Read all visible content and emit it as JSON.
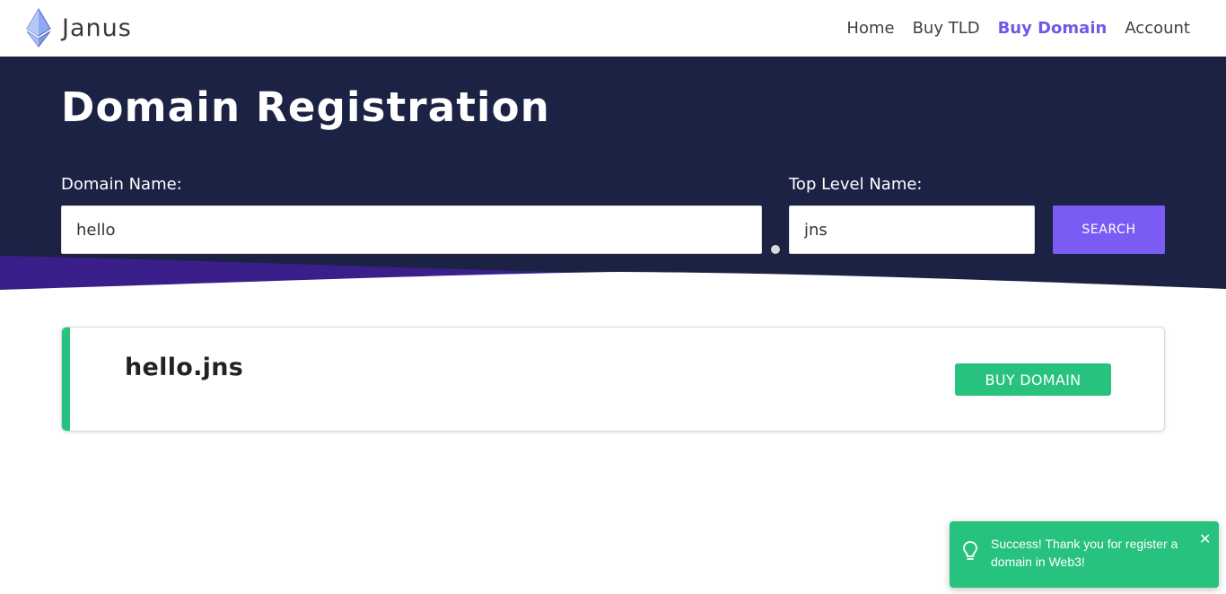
{
  "nav": {
    "brand": "Janus",
    "brand_icon": "ethereum-diamond-icon",
    "links": [
      {
        "label": "Home",
        "active": false
      },
      {
        "label": "Buy TLD",
        "active": false
      },
      {
        "label": "Buy Domain",
        "active": true
      },
      {
        "label": "Account",
        "active": false
      }
    ]
  },
  "hero": {
    "title": "Domain Registration",
    "domain_label": "Domain Name:",
    "domain_value": "hello",
    "tld_label": "Top Level Name:",
    "tld_value": "jns",
    "search_label": "SEARCH"
  },
  "result": {
    "domain": "hello.jns",
    "buy_label": "BUY DOMAIN"
  },
  "toast": {
    "message": "Success! Thank you for register a domain in Web3!",
    "icon": "lightbulb-icon",
    "close_icon": "close-icon"
  },
  "colors": {
    "accent": "#7356ea",
    "hero_bg": "#1c2244",
    "success": "#27c27e",
    "wave_purple": "#3a1f8a"
  }
}
